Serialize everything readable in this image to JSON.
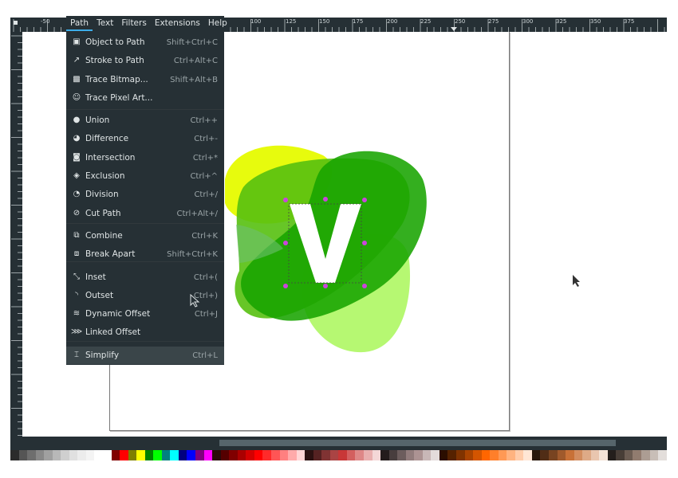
{
  "menubar": {
    "items": [
      "Path",
      "Text",
      "Filters",
      "Extensions",
      "Help"
    ],
    "active": "Path"
  },
  "ruler": {
    "top_labels": [
      "-50",
      "100",
      "125",
      "150",
      "175",
      "200",
      "225",
      "250",
      "275",
      "300",
      "325",
      "350",
      "375"
    ]
  },
  "path_menu": {
    "items": [
      {
        "label": "Object to Path",
        "shortcut": "Shift+Ctrl+C",
        "icon": "object-to-path-icon"
      },
      {
        "label": "Stroke to Path",
        "shortcut": "Ctrl+Alt+C",
        "icon": "stroke-to-path-icon"
      },
      {
        "label": "Trace Bitmap...",
        "shortcut": "Shift+Alt+B",
        "icon": "trace-bitmap-icon"
      },
      {
        "label": "Trace Pixel Art...",
        "shortcut": "",
        "icon": "trace-pixel-art-icon"
      },
      {
        "label": "Union",
        "shortcut": "Ctrl++",
        "icon": "union-icon"
      },
      {
        "label": "Difference",
        "shortcut": "Ctrl+-",
        "icon": "difference-icon"
      },
      {
        "label": "Intersection",
        "shortcut": "Ctrl+*",
        "icon": "intersection-icon"
      },
      {
        "label": "Exclusion",
        "shortcut": "Ctrl+^",
        "icon": "exclusion-icon"
      },
      {
        "label": "Division",
        "shortcut": "Ctrl+/",
        "icon": "division-icon"
      },
      {
        "label": "Cut Path",
        "shortcut": "Ctrl+Alt+/",
        "icon": "cut-path-icon"
      },
      {
        "label": "Combine",
        "shortcut": "Ctrl+K",
        "icon": "combine-icon"
      },
      {
        "label": "Break Apart",
        "shortcut": "Shift+Ctrl+K",
        "icon": "break-apart-icon"
      },
      {
        "label": "Inset",
        "shortcut": "Ctrl+(",
        "icon": "inset-icon"
      },
      {
        "label": "Outset",
        "shortcut": "Ctrl+)",
        "icon": "outset-icon"
      },
      {
        "label": "Dynamic Offset",
        "shortcut": "Ctrl+J",
        "icon": "dynamic-offset-icon"
      },
      {
        "label": "Linked Offset",
        "shortcut": "",
        "icon": "linked-offset-icon"
      },
      {
        "label": "Simplify",
        "shortcut": "Ctrl+L",
        "icon": "simplify-icon",
        "highlighted": true
      }
    ]
  },
  "canvas": {
    "logo_letter": "V"
  },
  "colors": {
    "chrome": "#263035",
    "accent": "#3daee9",
    "handle": "#cc44dd"
  },
  "palette": [
    "#2b2b2b",
    "#555555",
    "#6e6e6e",
    "#888888",
    "#a0a0a0",
    "#b8b8b8",
    "#cfcfcf",
    "#e0e0e0",
    "#ececec",
    "#f4f4f4",
    "#ffffff",
    "#ffffff",
    "#800000",
    "#ff0000",
    "#808000",
    "#ffff00",
    "#008000",
    "#00ff00",
    "#008080",
    "#00ffff",
    "#000080",
    "#0000ff",
    "#800080",
    "#ff00ff",
    "#2a0a0a",
    "#550000",
    "#800000",
    "#aa0000",
    "#d40000",
    "#ff0000",
    "#ff2a2a",
    "#ff5555",
    "#ff8080",
    "#ffaaaa",
    "#ffd5d5",
    "#2b1111",
    "#552222",
    "#803333",
    "#aa4444",
    "#c83737",
    "#d35f5f",
    "#de8787",
    "#e9afaf",
    "#f4d7d7",
    "#241c1c",
    "#483e3e",
    "#6c5d5d",
    "#917c7c",
    "#ac9393",
    "#c8b7b7",
    "#e3dbdb",
    "#2b0e00",
    "#552200",
    "#803300",
    "#aa4400",
    "#d45500",
    "#ff6600",
    "#ff7f2a",
    "#ff9955",
    "#ffb380",
    "#ffccaa",
    "#ffe6d5",
    "#28170b",
    "#502d16",
    "#784421",
    "#a05a2c",
    "#c87137",
    "#d38d5f",
    "#deaa87",
    "#e9c6af",
    "#f4e3d7",
    "#241f1c",
    "#483e37",
    "#6c5d53",
    "#917c6f",
    "#ac9d93",
    "#c8beb7",
    "#e3dedb"
  ]
}
